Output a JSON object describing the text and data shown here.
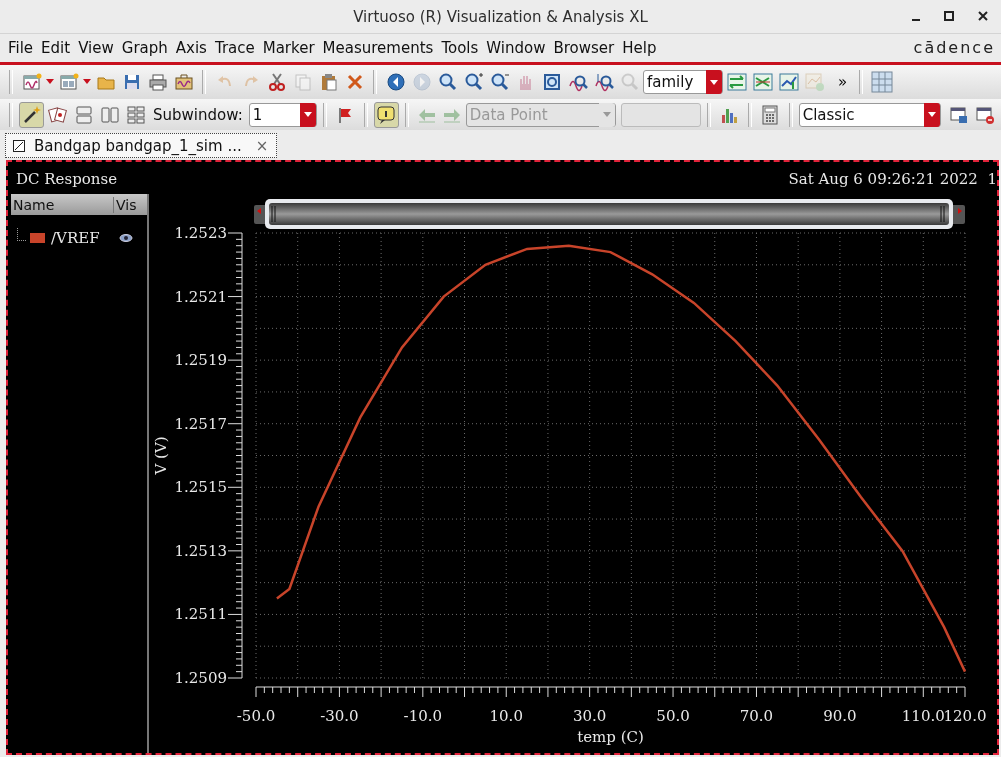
{
  "window": {
    "title": "Virtuoso (R) Visualization & Analysis XL"
  },
  "menu": [
    {
      "label": "File"
    },
    {
      "label": "Edit"
    },
    {
      "label": "View"
    },
    {
      "label": "Graph"
    },
    {
      "label": "Axis"
    },
    {
      "label": "Trace"
    },
    {
      "label": "Marker"
    },
    {
      "label": "Measurements"
    },
    {
      "label": "Tools"
    },
    {
      "label": "Window"
    },
    {
      "label": "Browser"
    },
    {
      "label": "Help"
    }
  ],
  "logo": "cādence",
  "toolbar_1": {
    "buttons": [
      {
        "disabled": false
      },
      {
        "disabled": false
      },
      {
        "disabled": false
      },
      {
        "disabled": false
      },
      {
        "disabled": false
      },
      {
        "disabled": false
      },
      {
        "disabled": true
      },
      {
        "disabled": true
      },
      {
        "disabled": false
      },
      {
        "disabled": true
      },
      {
        "disabled": false
      },
      {
        "disabled": false
      },
      {
        "disabled": false
      },
      {
        "disabled": true
      },
      {
        "disabled": false
      },
      {
        "disabled": false
      },
      {
        "disabled": false
      },
      {
        "disabled": true
      },
      {
        "disabled": false
      },
      {
        "disabled": false
      },
      {
        "disabled": false
      },
      {
        "disabled": true
      },
      {
        "disabled": false
      },
      {
        "disabled": false
      },
      {
        "disabled": false
      },
      {
        "disabled": true
      }
    ],
    "combo": "family",
    "overflow": "»"
  },
  "toolbar_2": {
    "subwindow_label": "Subwindow:",
    "subwindow": "1",
    "info_pressed": true,
    "data_point": "Data Point",
    "style": "Classic"
  },
  "tabs": [
    {
      "label": "Bandgap bandgap_1_sim ...",
      "selected": true,
      "close": "×"
    }
  ],
  "panel": {
    "title": "DC Response",
    "timestamp": "Sat Aug 6 09:26:21 2022",
    "timestamp_cut": "1"
  },
  "legend": {
    "columns": [
      "Name",
      "Vis"
    ],
    "items": [
      {
        "visible": true
      }
    ]
  },
  "chart_data": {
    "type": "line",
    "grid": true,
    "xlabel": "temp (C)",
    "ylabel": "V (V)",
    "x": [
      -45,
      -42,
      -35,
      -25,
      -15,
      -5,
      5,
      15,
      25,
      35,
      45,
      55,
      65,
      75,
      85,
      95,
      105,
      115,
      120
    ],
    "series": [
      {
        "name": "/VREF",
        "color": "#c8442a",
        "values": [
          1.25115,
          1.25118,
          1.25144,
          1.25172,
          1.25194,
          1.2521,
          1.2522,
          1.25225,
          1.25226,
          1.25224,
          1.25217,
          1.25208,
          1.25196,
          1.25182,
          1.25165,
          1.25147,
          1.2513,
          1.25106,
          1.25092
        ]
      }
    ],
    "xlim": [
      -50,
      120
    ],
    "ylim": [
      1.2509,
      1.2523
    ],
    "xticks": [
      {
        "value": -50,
        "label": "-50.0"
      },
      {
        "value": -30,
        "label": "-30.0"
      },
      {
        "value": -10,
        "label": "-10.0"
      },
      {
        "value": 10,
        "label": "10.0"
      },
      {
        "value": 30,
        "label": "30.0"
      },
      {
        "value": 50,
        "label": "50.0"
      },
      {
        "value": 70,
        "label": "70.0"
      },
      {
        "value": 90,
        "label": "90.0"
      },
      {
        "value": 110,
        "label": "110.0"
      },
      {
        "value": 120,
        "label": "120.0"
      }
    ],
    "yticks": [
      {
        "value": 1.2509,
        "label": "1.2509"
      },
      {
        "value": 1.2511,
        "label": "1.2511"
      },
      {
        "value": 1.2513,
        "label": "1.2513"
      },
      {
        "value": 1.2515,
        "label": "1.2515"
      },
      {
        "value": 1.2517,
        "label": "1.2517"
      },
      {
        "value": 1.2519,
        "label": "1.2519"
      },
      {
        "value": 1.2521,
        "label": "1.2521"
      },
      {
        "value": 1.2523,
        "label": "1.2523"
      }
    ]
  }
}
